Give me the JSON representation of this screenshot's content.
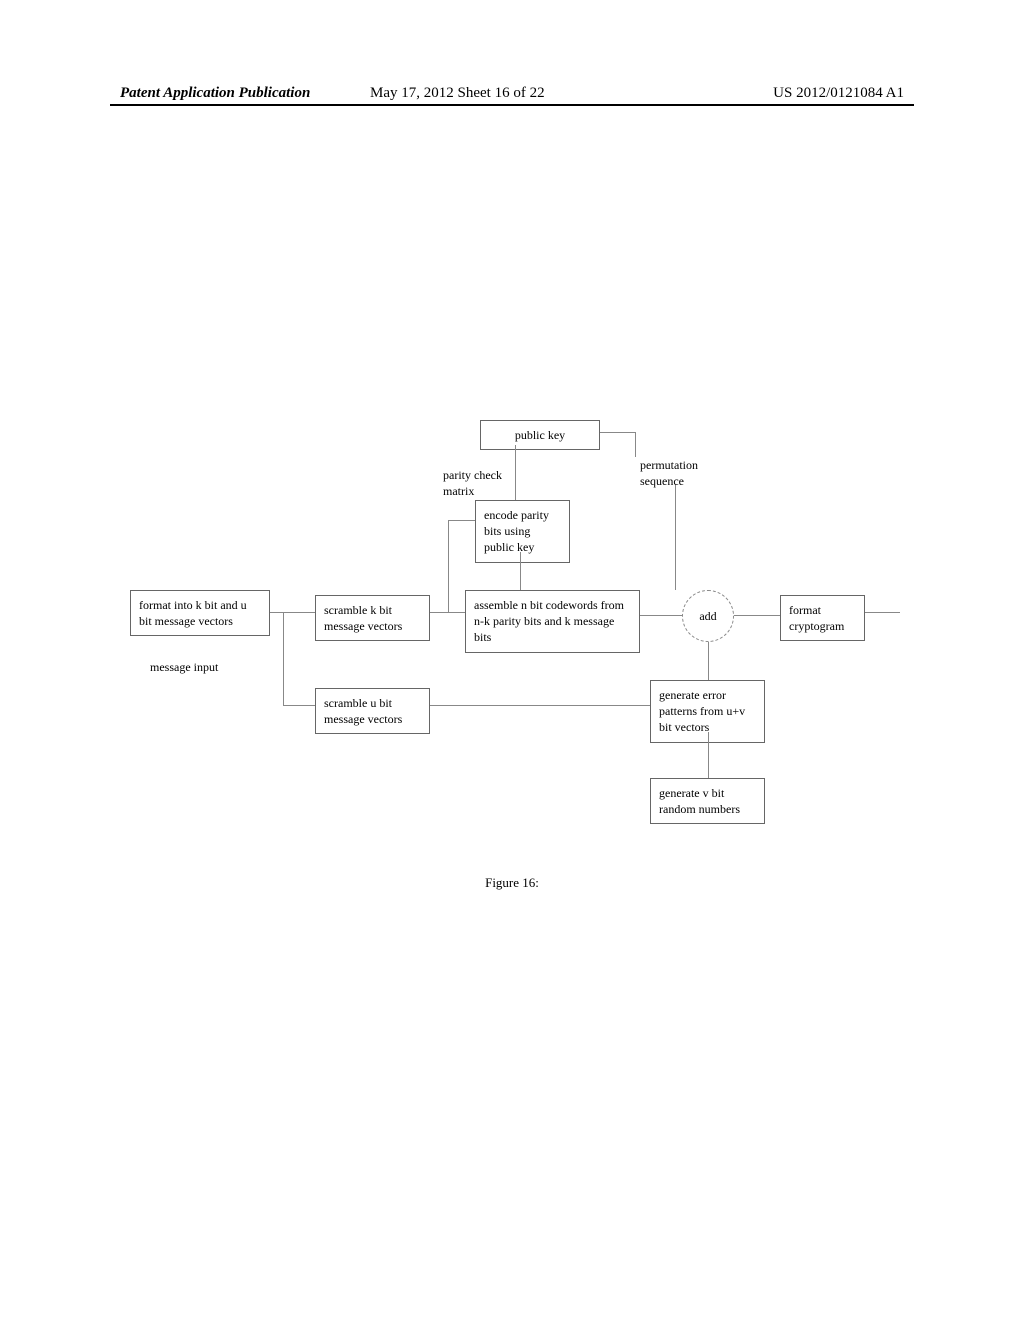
{
  "header": {
    "left": "Patent Application Publication",
    "center": "May 17, 2012  Sheet 16 of 22",
    "right": "US 2012/0121084 A1"
  },
  "diagram": {
    "format_input": "format into k bit and u bit message vectors",
    "message_input": "message input",
    "scramble_k": "scramble k bit message vectors",
    "scramble_u": "scramble u bit message vectors",
    "public_key": "public key",
    "parity_check": "parity check matrix",
    "permutation": "permutation sequence",
    "encode_parity": "encode parity bits using public key",
    "assemble": "assemble n bit codewords from n-k  parity bits and k message bits",
    "add": "add",
    "generate_error": "generate error patterns from u+v bit vectors",
    "generate_v": "generate v bit random numbers",
    "format_output": "format cryptogram"
  },
  "caption": "Figure 16:"
}
